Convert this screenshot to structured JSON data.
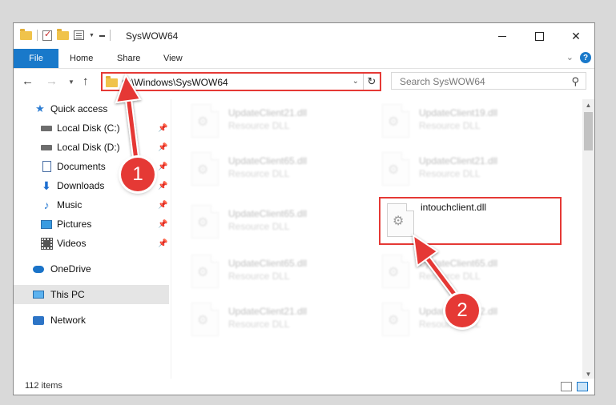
{
  "window": {
    "title": "SysWOW64",
    "controls": {
      "minimize": "minimize",
      "maximize": "maximize",
      "close": "✕"
    }
  },
  "ribbon": {
    "tabs": [
      "File",
      "Home",
      "Share",
      "View"
    ]
  },
  "nav": {
    "address": "C:\\Windows\\SysWOW64",
    "search_placeholder": "Search SysWOW64"
  },
  "sidebar": {
    "items": [
      {
        "label": "Quick access",
        "icon": "star-icon"
      },
      {
        "label": "Local Disk (C:)",
        "icon": "drive-icon",
        "pinned": true
      },
      {
        "label": "Local Disk (D:)",
        "icon": "drive-icon",
        "pinned": true
      },
      {
        "label": "Documents",
        "icon": "documents-icon",
        "pinned": true
      },
      {
        "label": "Downloads",
        "icon": "download-icon",
        "pinned": true
      },
      {
        "label": "Music",
        "icon": "music-icon",
        "pinned": true
      },
      {
        "label": "Pictures",
        "icon": "pictures-icon",
        "pinned": true
      },
      {
        "label": "Videos",
        "icon": "videos-icon",
        "pinned": true
      },
      {
        "label": "OneDrive",
        "icon": "cloud-icon"
      },
      {
        "label": "This PC",
        "icon": "computer-icon",
        "selected": true
      },
      {
        "label": "Network",
        "icon": "network-icon"
      }
    ]
  },
  "files": [
    {
      "name": "UpdateClient21.dll",
      "type": "Resource DLL"
    },
    {
      "name": "UpdateClient19.dll",
      "type": "Resource DLL"
    },
    {
      "name": "UpdateClient65.dll",
      "type": "Resource DLL"
    },
    {
      "name": "UpdateClient21.dll",
      "type": "Resource DLL"
    },
    {
      "name": "UpdateClient65.dll",
      "type": "Resource DLL"
    },
    {
      "name": "intouchclient.dll",
      "type": "",
      "highlighted": true
    },
    {
      "name": "UpdateClient65.dll",
      "type": "Resource DLL"
    },
    {
      "name": "UpdateClient65.dll",
      "type": "Resource DLL"
    },
    {
      "name": "UpdateClient21.dll",
      "type": "Resource DLL"
    },
    {
      "name": "UpdateClient42.dll",
      "type": "Resource DLL"
    }
  ],
  "status": {
    "item_count": "112 items"
  },
  "callouts": [
    "1",
    "2"
  ],
  "colors": {
    "accent": "#1979ca",
    "annotation": "#e53935"
  }
}
